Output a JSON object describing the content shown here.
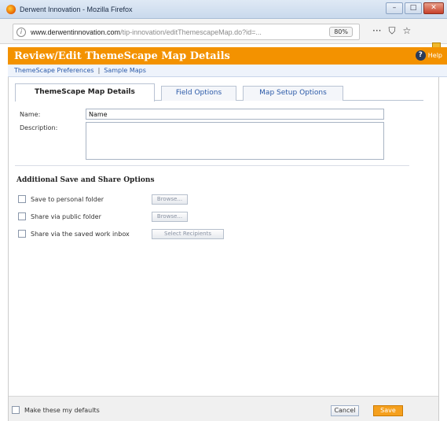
{
  "window": {
    "title": "Derwent Innovation - Mozilla Firefox",
    "controls": [
      "minimize",
      "maximize",
      "close"
    ]
  },
  "browser": {
    "url_host": "www.derwentinnovation.com",
    "url_path": "/tip-innovation/editThemescapeMap.do?id=...",
    "zoom": "80%",
    "more_label": "···",
    "icons": [
      "info-icon",
      "pocket-icon",
      "bookmark-star-icon",
      "extension-icon"
    ]
  },
  "header": {
    "title": "Review/Edit ThemeScape Map Details",
    "help_label": "Help",
    "accent_color": "#f39200"
  },
  "links": {
    "preferences": "ThemeScape Preferences",
    "separator": "|",
    "sample_maps": "Sample Maps"
  },
  "tabs": [
    {
      "label": "ThemeScape Map Details",
      "active": true
    },
    {
      "label": "Field Options",
      "active": false
    },
    {
      "label": "Map Setup Options",
      "active": false
    }
  ],
  "form": {
    "name_label": "Name:",
    "name_value": "Name",
    "description_label": "Description:",
    "description_value": ""
  },
  "share": {
    "heading": "Additional Save and Share Options",
    "options": [
      {
        "label": "Save to personal folder",
        "button": "Browse...",
        "checked": false
      },
      {
        "label": "Share via public folder",
        "button": "Browse...",
        "checked": false
      },
      {
        "label": "Share via the saved work inbox",
        "button": "Select Recipients",
        "checked": false
      }
    ]
  },
  "footer": {
    "defaults_label": "Make these my defaults",
    "cancel_label": "Cancel",
    "save_label": "Save"
  }
}
